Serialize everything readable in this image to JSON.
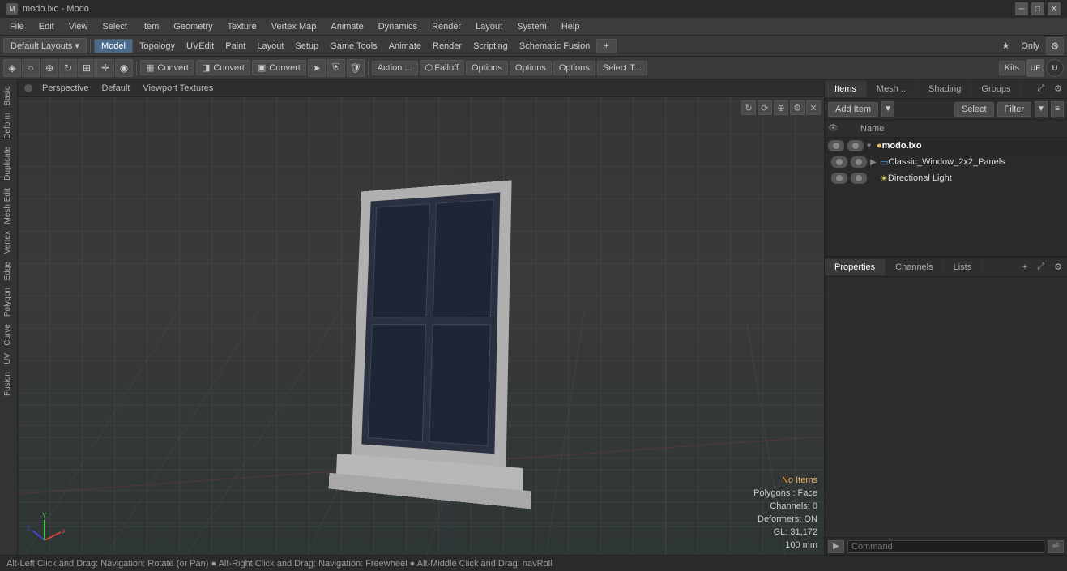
{
  "titlebar": {
    "title": "modo.lxo - Modo",
    "icon": "M"
  },
  "menubar": {
    "items": [
      "File",
      "Edit",
      "View",
      "Select",
      "Item",
      "Geometry",
      "Texture",
      "Vertex Map",
      "Animate",
      "Dynamics",
      "Render",
      "Layout",
      "System",
      "Help"
    ]
  },
  "toolbar1": {
    "layouts_btn": "Default Layouts ▾",
    "tabs": [
      "Model",
      "Topology",
      "UVEdit",
      "Paint",
      "Layout",
      "Setup",
      "Game Tools",
      "Animate",
      "Render",
      "Scripting",
      "Schematic Fusion"
    ],
    "active_tab": "Model",
    "plus_btn": "+",
    "star_label": "Only",
    "gear_label": "⚙"
  },
  "toolbar2": {
    "convert_btns": [
      "Convert",
      "Convert",
      "Convert"
    ],
    "action_btn": "Action ...",
    "falloff_btn": "Falloff",
    "options_btns": [
      "Options",
      "Options",
      "Options"
    ],
    "select_btn": "Select T...",
    "options2_btn": "Options",
    "kits_btn": "Kits",
    "icons": [
      "●",
      "○",
      "△",
      "□",
      "◇",
      "⬡",
      "⊕",
      "◉",
      "↺",
      "●",
      "○",
      "◎",
      "◉",
      "▶",
      "⊡",
      "⬢"
    ]
  },
  "viewport": {
    "view_type": "Perspective",
    "render_mode": "Default",
    "shading": "Viewport Textures",
    "stats": {
      "no_items": "No Items",
      "polygons": "Polygons : Face",
      "channels": "Channels: 0",
      "deformers": "Deformers: ON",
      "gl": "GL: 31,172",
      "size": "100 mm"
    }
  },
  "statusbar": {
    "text": "Alt-Left Click and Drag: Navigation: Rotate (or Pan)  ●  Alt-Right Click and Drag: Navigation: Freewheel  ●  Alt-Middle Click and Drag: navRoll"
  },
  "right_panel": {
    "items_tabs": [
      "Items",
      "Mesh ...",
      "Shading",
      "Groups"
    ],
    "active_items_tab": "Items",
    "add_item_btn": "Add Item",
    "select_btn": "Select",
    "filter_btn": "Filter",
    "name_col": "Name",
    "tree": [
      {
        "id": "root",
        "name": "modo.lxo",
        "level": 0,
        "type": "root",
        "eye": true,
        "expanded": true
      },
      {
        "id": "mesh",
        "name": "Classic_Window_2x2_Panels",
        "level": 1,
        "type": "mesh",
        "eye": true,
        "expanded": false
      },
      {
        "id": "light",
        "name": "Directional Light",
        "level": 1,
        "type": "light",
        "eye": true,
        "expanded": false
      }
    ],
    "props_tabs": [
      "Properties",
      "Channels",
      "Lists"
    ],
    "active_props_tab": "Properties",
    "command_placeholder": "Command"
  }
}
